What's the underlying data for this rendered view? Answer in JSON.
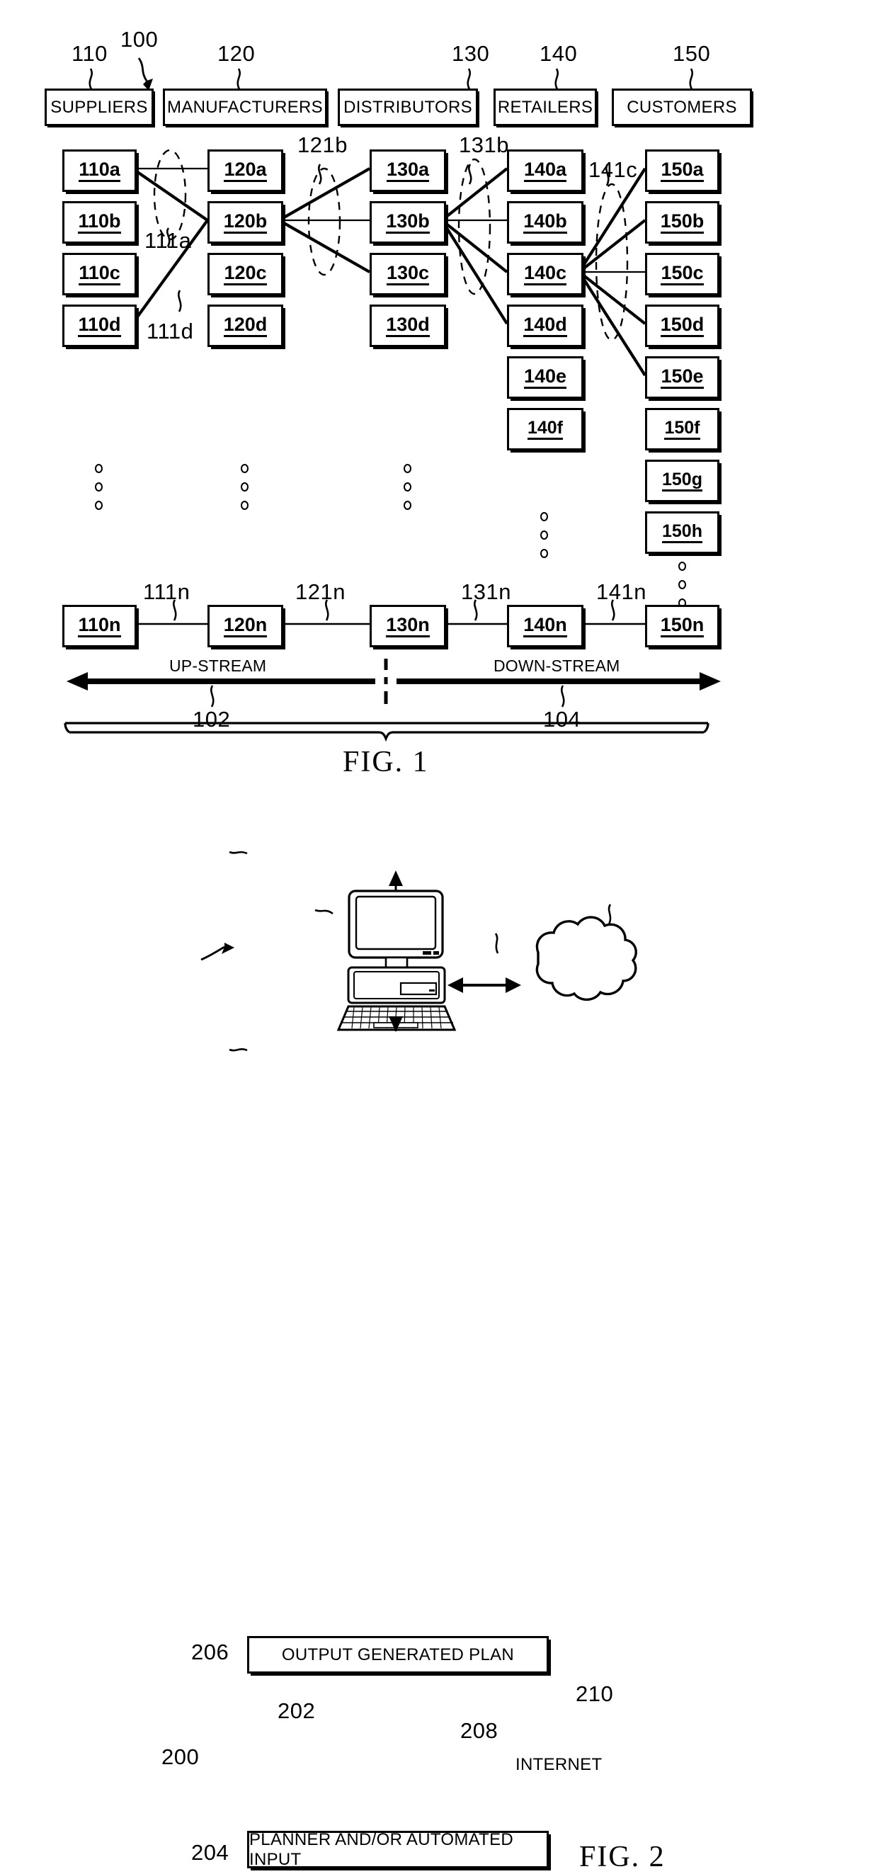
{
  "figure1": {
    "id_label": "100",
    "caption": "FIG. 1",
    "columns": [
      {
        "ref": "110",
        "header": "SUPPLIERS",
        "nodes": [
          "110a",
          "110b",
          "110c",
          "110d"
        ],
        "tail": "110n"
      },
      {
        "ref": "120",
        "header": "MANUFACTURERS",
        "nodes": [
          "120a",
          "120b",
          "120c",
          "120d"
        ],
        "tail": "120n"
      },
      {
        "ref": "130",
        "header": "DISTRIBUTORS",
        "nodes": [
          "130a",
          "130b",
          "130c",
          "130d"
        ],
        "tail": "130n"
      },
      {
        "ref": "140",
        "header": "RETAILERS",
        "nodes": [
          "140a",
          "140b",
          "140c",
          "140d",
          "140e",
          "140f"
        ],
        "tail": "140n"
      },
      {
        "ref": "150",
        "header": "CUSTOMERS",
        "nodes": [
          "150a",
          "150b",
          "150c",
          "150d",
          "150e",
          "150f",
          "150g",
          "150h"
        ],
        "tail": "150n"
      }
    ],
    "link_labels": [
      "111a",
      "111d",
      "121b",
      "131b",
      "141c"
    ],
    "tail_link_labels": [
      "111n",
      "121n",
      "131n",
      "141n"
    ],
    "stream": {
      "upstream_label": "UP-STREAM",
      "upstream_ref": "102",
      "downstream_label": "DOWN-STREAM",
      "downstream_ref": "104"
    }
  },
  "figure2": {
    "id_label": "200",
    "caption": "FIG. 2",
    "output_box": {
      "ref": "206",
      "text": "OUTPUT GENERATED PLAN"
    },
    "computer": {
      "ref": "202"
    },
    "link": {
      "ref": "208"
    },
    "cloud": {
      "ref": "210",
      "text": "INTERNET"
    },
    "input_box": {
      "ref": "204",
      "text": "PLANNER AND/OR AUTOMATED INPUT"
    }
  }
}
